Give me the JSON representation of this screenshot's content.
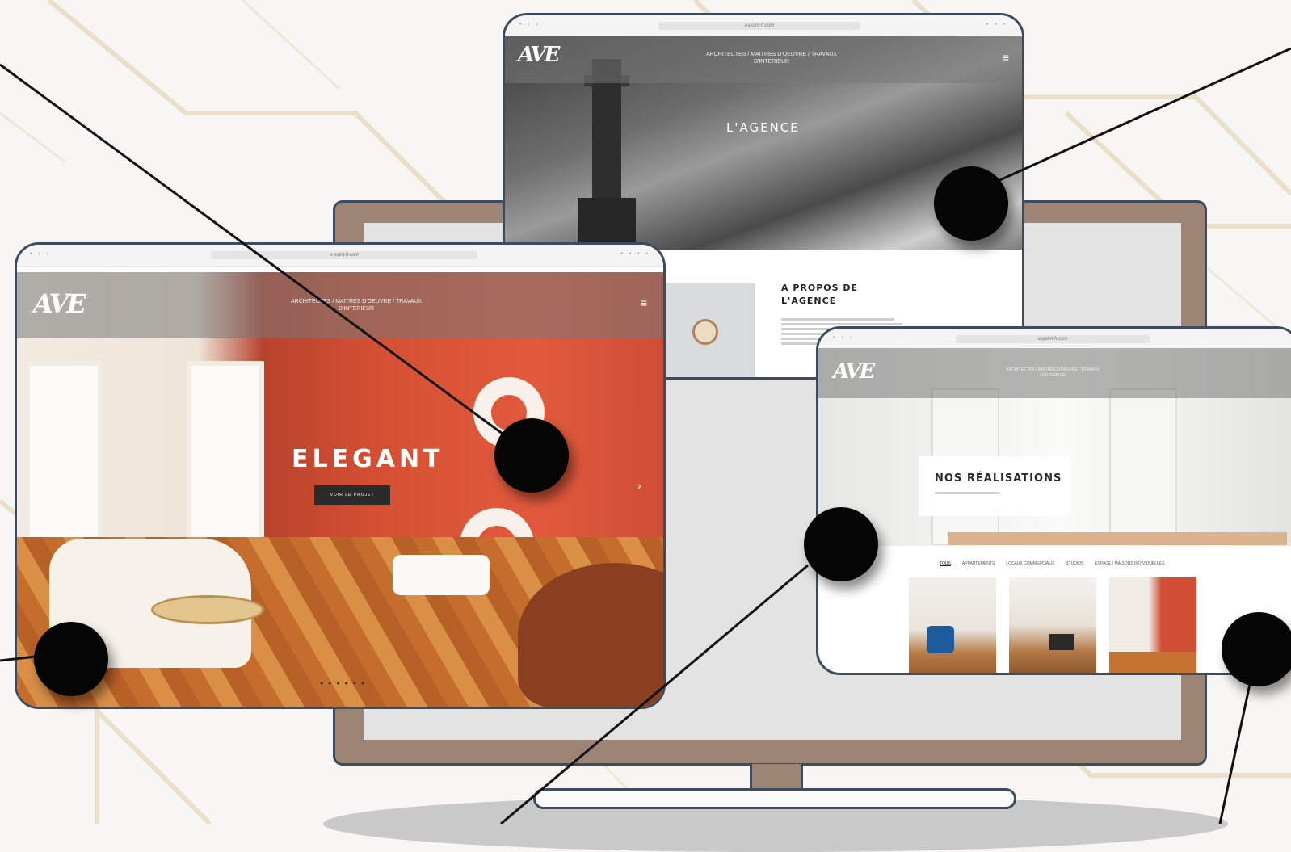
{
  "colors": {
    "background": "#f7f6f3",
    "deco_lines": "#e8dcc5",
    "monitor_frame": "#9c8575",
    "outline": "#3e4a5e",
    "accent_red": "#d44f33",
    "hotspot": "#050505"
  },
  "tablet_home": {
    "logo": "AVE",
    "nav_line1": "ARCHITECTES / MAITRES D'OEUVRE / TRAVAUX",
    "nav_line2": "D'INTERIEUR",
    "url": "a-point-fr.com",
    "headline": "ELEGANT",
    "cta": "VOIR LE PROJET",
    "menu_icon": "hamburger-icon"
  },
  "tablet_agence": {
    "logo": "AVE",
    "nav_line1": "ARCHITECTES / MAITRES D'OEUVRE / TRAVAUX",
    "nav_line2": "D'INTERIEUR",
    "url": "a-point-fr.com",
    "section_title": "L'AGENCE",
    "about_title_line1": "A PROPOS DE",
    "about_title_line2": "L'AGENCE"
  },
  "tablet_realisations": {
    "logo": "AVE",
    "nav_line1": "ARCHITECTES / MAITRES D'OEUVRE / TRAVAUX",
    "nav_line2": "D'INTERIEUR",
    "url": "a-point-fr.com",
    "card_title": "NOS RÉALISATIONS",
    "filters": [
      "TOUS",
      "APPARTEMENTS",
      "LOCAUX COMMERCIAUX",
      "STUDIOS",
      "ESPACE / MAISONS INDIVIDUELLES"
    ]
  }
}
